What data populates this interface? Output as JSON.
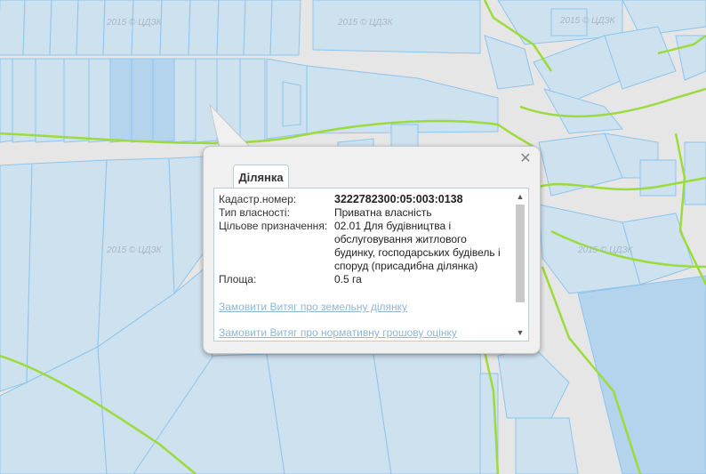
{
  "map": {
    "watermark": "2015 © ЦДЗК",
    "colors": {
      "background": "#e6e6e6",
      "parcel_fill": "#cde1ef",
      "parcel_fill_highlight": "#b4d3ec",
      "parcel_stroke": "#8cc5ee",
      "boundary_line": "#9cdb3c"
    }
  },
  "popup": {
    "tab_label": "Ділянка",
    "close_icon": "close-icon",
    "fields": [
      {
        "label": "Кадастр.номер:",
        "value": "3222782300:05:003:0138"
      },
      {
        "label": "Тип власності:",
        "value": "Приватна власність"
      },
      {
        "label": "Цільове призначення:",
        "value": "02.01 Для будівництва і обслуговування житлового будинку, господарських будівель і споруд (присадибна ділянка)"
      },
      {
        "label": "Площа:",
        "value": "0.5 га"
      }
    ],
    "links": [
      "Замовити Витяг про земельну ділянку",
      "Замовити Витяг про нормативну грошову оцінку"
    ]
  }
}
